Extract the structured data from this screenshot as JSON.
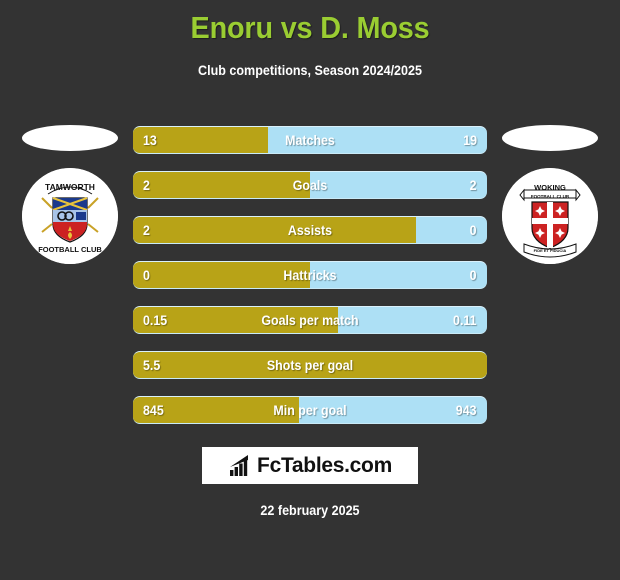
{
  "header": {
    "title": "Enoru vs D. Moss",
    "subtitle": "Club competitions, Season 2024/2025",
    "title_color": "#9ACD32"
  },
  "clubs": {
    "home": {
      "name": "Tamworth Football Club",
      "short": "TAMWORTH",
      "sub": "FOOTBALL CLUB"
    },
    "away": {
      "name": "Woking Football Club",
      "short": "WOKING",
      "sub": "FOOTBALL CLUB"
    }
  },
  "colors": {
    "background": "#333333",
    "home_bar": "#B8A317",
    "away_bar": "#ADE0F5",
    "text": "#FFFFFF"
  },
  "chart_data": {
    "type": "bar",
    "title": "Enoru vs D. Moss",
    "subtitle": "Club competitions, Season 2024/2025",
    "orientation": "horizontal-diverging",
    "series": [
      {
        "name": "Enoru (Tamworth)",
        "color": "#B8A317",
        "values": [
          13,
          2,
          2,
          0,
          0.15,
          5.5,
          845
        ]
      },
      {
        "name": "D. Moss (Woking)",
        "color": "#ADE0F5",
        "values": [
          19,
          2,
          0,
          0,
          0.11,
          null,
          943
        ]
      }
    ],
    "categories": [
      "Matches",
      "Goals",
      "Assists",
      "Hattricks",
      "Goals per match",
      "Shots per goal",
      "Min per goal"
    ],
    "rows": [
      {
        "label": "Matches",
        "home": "13",
        "away": "19",
        "home_pct": 38
      },
      {
        "label": "Goals",
        "home": "2",
        "away": "2",
        "home_pct": 50
      },
      {
        "label": "Assists",
        "home": "2",
        "away": "0",
        "home_pct": 80
      },
      {
        "label": "Hattricks",
        "home": "0",
        "away": "0",
        "home_pct": 50
      },
      {
        "label": "Goals per match",
        "home": "0.15",
        "away": "0.11",
        "home_pct": 58
      },
      {
        "label": "Shots per goal",
        "home": "5.5",
        "away": "",
        "home_pct": 100
      },
      {
        "label": "Min per goal",
        "home": "845",
        "away": "943",
        "home_pct": 47
      }
    ]
  },
  "footer": {
    "logo_text": "FcTables.com",
    "logo_icon": "bar-chart-icon",
    "date": "22 february 2025"
  }
}
